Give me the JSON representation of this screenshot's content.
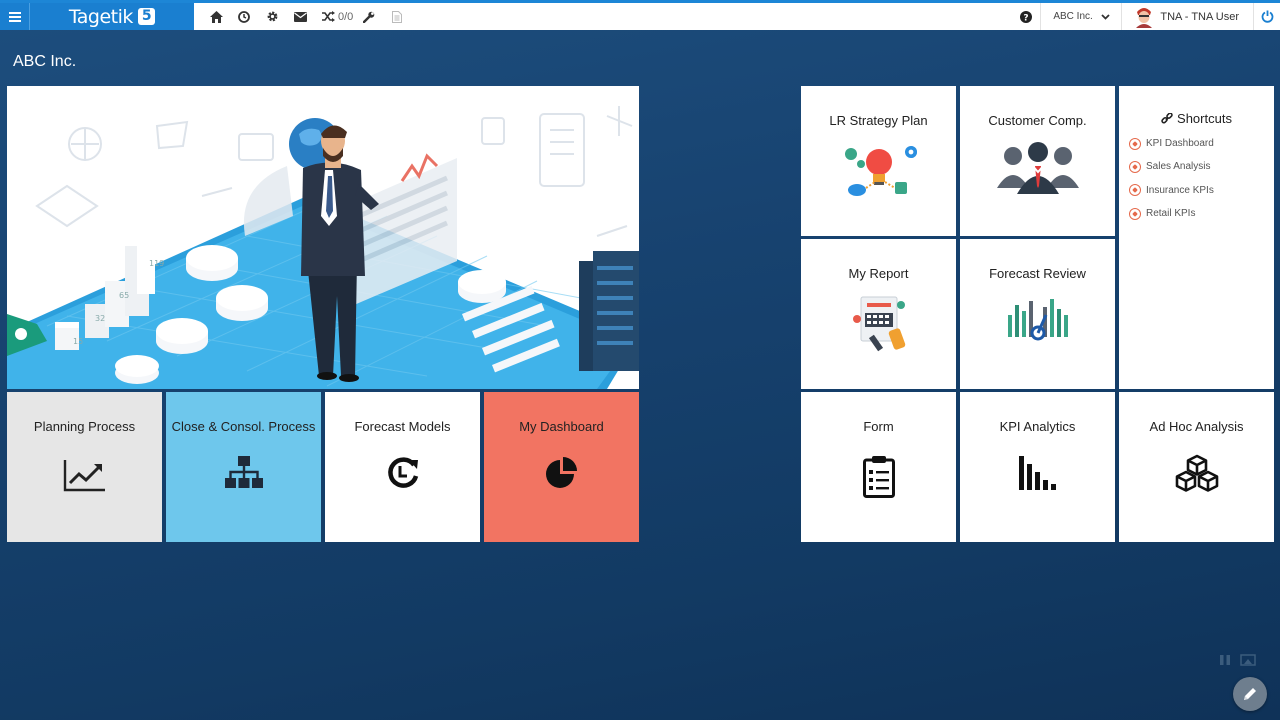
{
  "app": {
    "logo_text": "Tagetik",
    "logo_version": "5"
  },
  "toolbar": {
    "counter": "0/0",
    "entity": "ABC Inc.",
    "user": "TNA - TNA User"
  },
  "page": {
    "company": "ABC Inc."
  },
  "left_tiles": [
    {
      "label": "Planning Process",
      "icon": "line-chart-icon",
      "bg": "#e6e6e6"
    },
    {
      "label": "Close & Consol. Process",
      "icon": "org-chart-icon",
      "bg": "#6ec7ec"
    },
    {
      "label": "Forecast Models",
      "icon": "clock-refresh-icon",
      "bg": "#ffffff"
    },
    {
      "label": "My Dashboard",
      "icon": "pie-chart-icon",
      "bg": "#f27462"
    }
  ],
  "right_tiles": {
    "lr_strategy": "LR Strategy Plan",
    "customer_comp": "Customer Comp.",
    "my_report": "My Report",
    "forecast_review": "Forecast Review",
    "form": "Form",
    "kpi_analytics": "KPI Analytics",
    "adhoc": "Ad Hoc Analysis"
  },
  "shortcuts": {
    "title": "Shortcuts",
    "items": [
      "KPI Dashboard",
      "Sales Analysis",
      "Insurance KPIs",
      "Retail KPIs"
    ]
  },
  "colors": {
    "brand_blue": "#1a7fd0",
    "background": "#17426f",
    "accent_red": "#f27462",
    "accent_cyan": "#6ec7ec"
  }
}
